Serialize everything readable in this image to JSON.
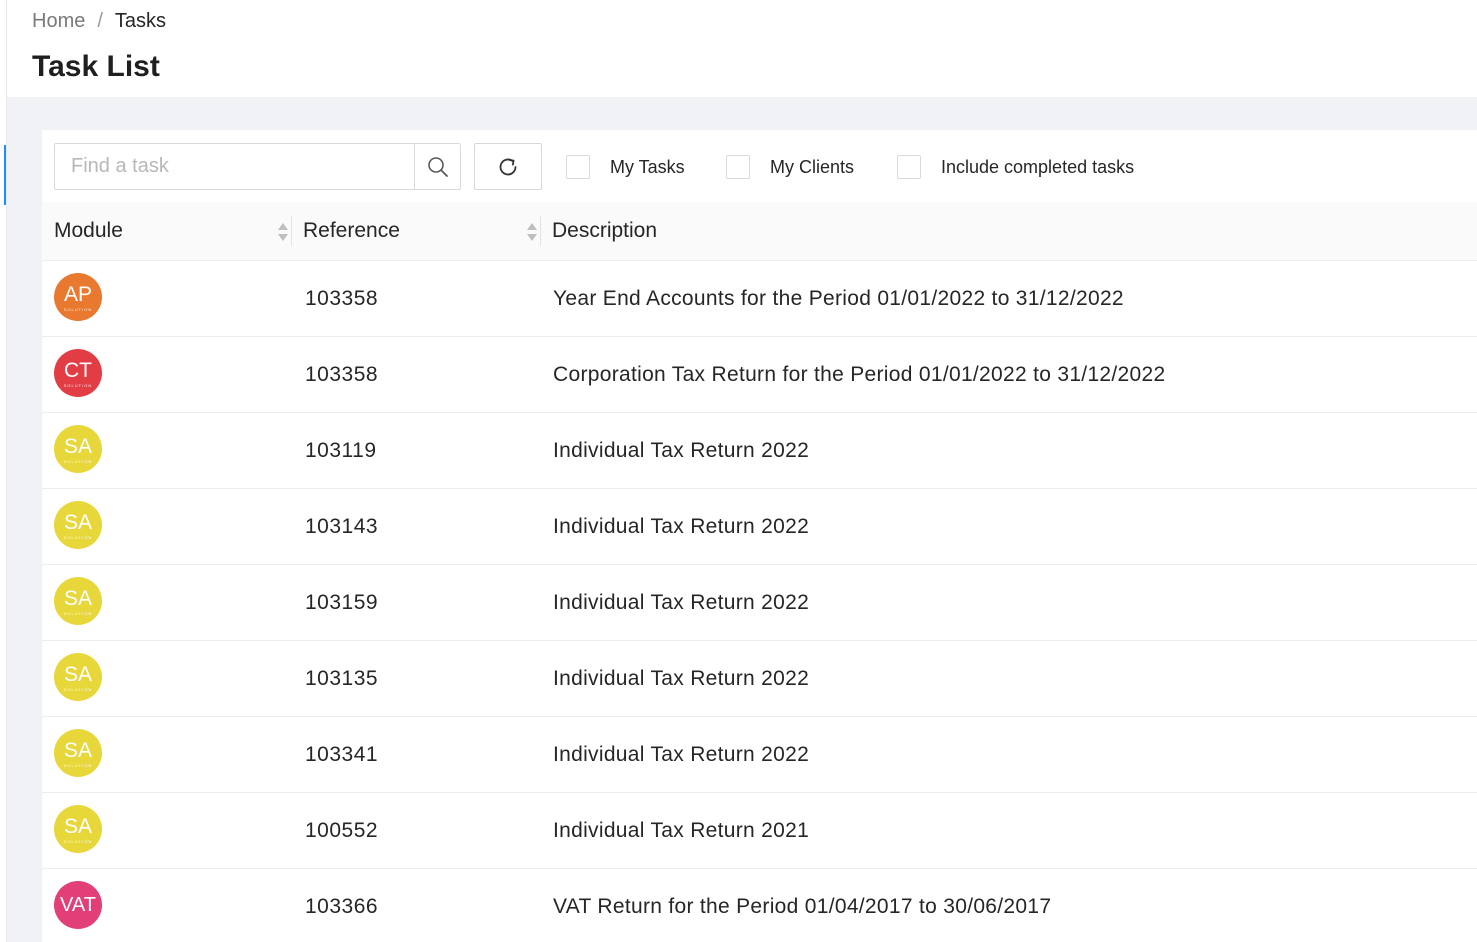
{
  "breadcrumb": {
    "home": "Home",
    "separator": "/",
    "current": "Tasks"
  },
  "page": {
    "title": "Task List"
  },
  "toolbar": {
    "search_placeholder": "Find a task",
    "search_icon": "search-icon",
    "refresh_icon": "refresh-icon",
    "filters": {
      "my_tasks": "My Tasks",
      "my_clients": "My Clients",
      "include_completed": "Include completed tasks"
    }
  },
  "table": {
    "columns": {
      "module": "Module",
      "reference": "Reference",
      "description": "Description"
    },
    "rows": [
      {
        "module_code": "AP",
        "module_sub": "SOLUTION",
        "module_color": "#e8792e",
        "reference": "103358",
        "description": "Year End Accounts for the Period 01/01/2022 to 31/12/2022"
      },
      {
        "module_code": "CT",
        "module_sub": "SOLUTION",
        "module_color": "#e23d45",
        "reference": "103358",
        "description": "Corporation Tax Return for the Period 01/01/2022 to 31/12/2022"
      },
      {
        "module_code": "SA",
        "module_sub": "SOLUTION",
        "module_color": "#e8d73a",
        "reference": "103119",
        "description": "Individual Tax Return 2022"
      },
      {
        "module_code": "SA",
        "module_sub": "SOLUTION",
        "module_color": "#e8d73a",
        "reference": "103143",
        "description": "Individual Tax Return 2022"
      },
      {
        "module_code": "SA",
        "module_sub": "SOLUTION",
        "module_color": "#e8d73a",
        "reference": "103159",
        "description": "Individual Tax Return 2022"
      },
      {
        "module_code": "SA",
        "module_sub": "SOLUTION",
        "module_color": "#e8d73a",
        "reference": "103135",
        "description": "Individual Tax Return 2022"
      },
      {
        "module_code": "SA",
        "module_sub": "SOLUTION",
        "module_color": "#e8d73a",
        "reference": "103341",
        "description": "Individual Tax Return 2022"
      },
      {
        "module_code": "SA",
        "module_sub": "SOLUTION",
        "module_color": "#e8d73a",
        "reference": "100552",
        "description": "Individual Tax Return 2021"
      },
      {
        "module_code": "VAT",
        "module_sub": "",
        "module_color": "#e23f78",
        "reference": "103366",
        "description": "VAT Return for the Period 01/04/2017 to 30/06/2017"
      }
    ]
  },
  "colors": {
    "accent": "#1890ff",
    "content_background": "#f0f2f5"
  }
}
